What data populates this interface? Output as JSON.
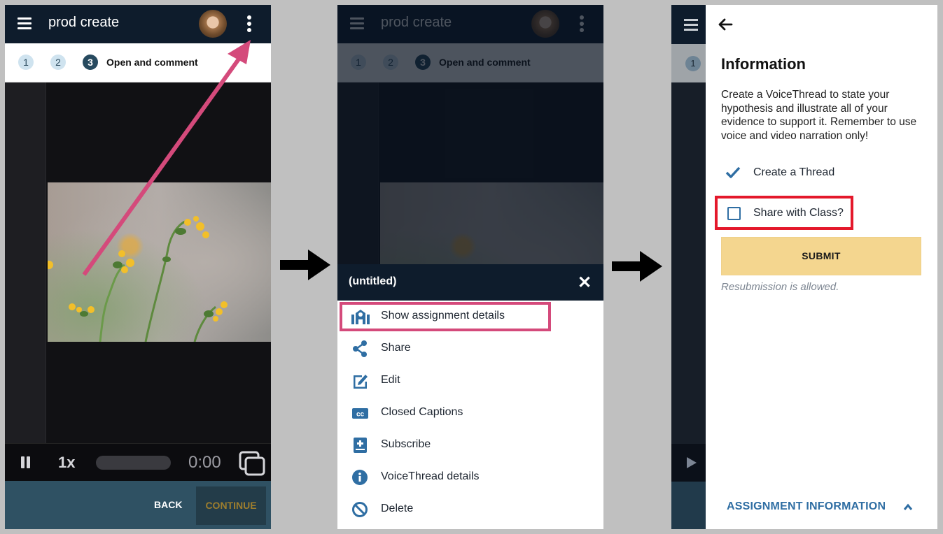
{
  "colors": {
    "topbar": "#0e1c2c",
    "accent_blue": "#2f6ea3",
    "highlight_pink": "#d44a7b",
    "highlight_red": "#e4182b",
    "submit_bg": "#f4d68f",
    "footer": "#2f5163",
    "continue_text": "#9c7d2e"
  },
  "panel1": {
    "app_title": "prod create",
    "steps": [
      {
        "number": "1",
        "state": "done"
      },
      {
        "number": "2",
        "state": "done"
      },
      {
        "number": "3",
        "state": "active",
        "label": "Open and comment"
      }
    ],
    "player": {
      "speed": "1x",
      "time": "0:00",
      "progress": 0
    },
    "footer": {
      "back_label": "BACK",
      "continue_label": "CONTINUE"
    },
    "icons": [
      "hamburger-menu-icon",
      "avatar",
      "more-vertical-icon",
      "pause-icon",
      "fullscreen-icon"
    ]
  },
  "panel2": {
    "app_title": "prod create",
    "steps": [
      {
        "number": "1"
      },
      {
        "number": "2"
      },
      {
        "number": "3",
        "label": "Open and comment"
      }
    ],
    "menu": {
      "title": "(untitled)",
      "close_icon": "close-icon",
      "items": [
        {
          "label": "Show assignment details",
          "icon": "school-building-icon",
          "highlighted": true
        },
        {
          "label": "Share",
          "icon": "share-icon"
        },
        {
          "label": "Edit",
          "icon": "edit-icon"
        },
        {
          "label": "Closed Captions",
          "icon": "closed-captions-icon"
        },
        {
          "label": "Subscribe",
          "icon": "subscribe-icon"
        },
        {
          "label": "VoiceThread details",
          "icon": "info-icon"
        },
        {
          "label": "Delete",
          "icon": "delete-icon"
        }
      ]
    }
  },
  "panel3": {
    "side_step": "1",
    "title": "Information",
    "description": "Create a VoiceThread to state your hypothesis and illustrate all of your evidence to support it. Remember to use voice and video narration only!",
    "tasks": [
      {
        "label": "Create a Thread",
        "completed": true
      },
      {
        "label": "Share with Class?",
        "completed": false,
        "highlighted": true
      }
    ],
    "submit_label": "SUBMIT",
    "resubmission_note": "Resubmission is allowed.",
    "assignment_link": "ASSIGNMENT INFORMATION"
  }
}
